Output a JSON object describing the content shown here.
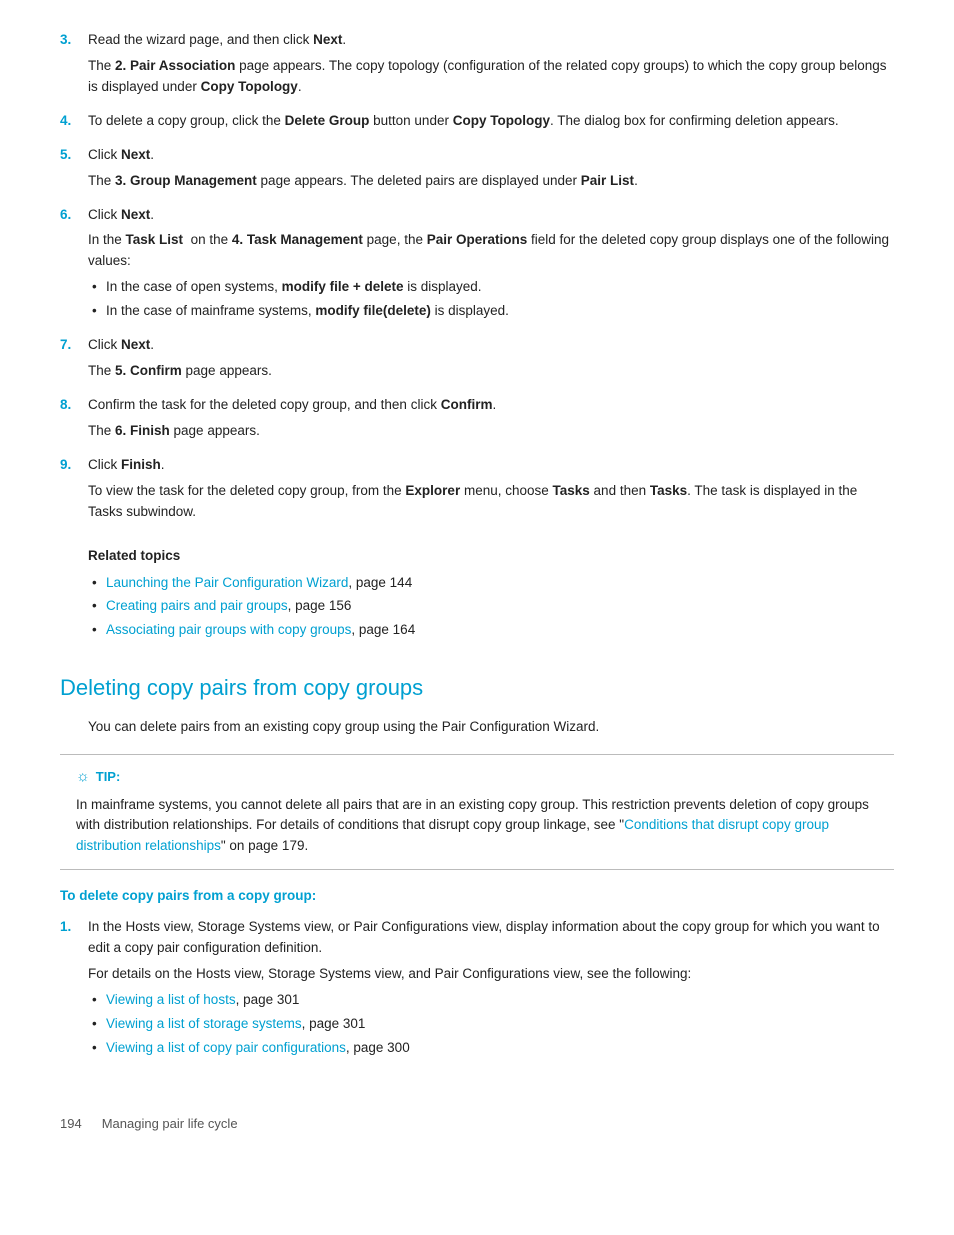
{
  "steps_top": [
    {
      "num": "3.",
      "main": "Read the wizard page, and then click <b>Next</b>.",
      "sub": "The <b>2. Pair Association</b> page appears. The copy topology (configuration of the related copy groups) to which the copy group belongs is displayed under <b>Copy Topology</b>."
    },
    {
      "num": "4.",
      "main": "To delete a copy group, click the <b>Delete Group</b> button under <b>Copy Topology</b>. The dialog box for confirming deletion appears.",
      "sub": ""
    },
    {
      "num": "5.",
      "main": "Click <b>Next</b>.",
      "sub": "The <b>3. Group Management</b> page appears. The deleted pairs are displayed under <b>Pair List</b>."
    },
    {
      "num": "6.",
      "main": "Click <b>Next</b>.",
      "sub": "In the <b>Task List</b>  on the <b>4. Task Management</b> page, the <b>Pair Operations</b> field for the deleted copy group displays one of the following values:"
    }
  ],
  "step6_bullets": [
    "In the case of open systems, <b>modify file + delete</b> is displayed.",
    "In the case of mainframe systems, <b>modify file(delete)</b> is displayed."
  ],
  "steps_bottom": [
    {
      "num": "7.",
      "main": "Click <b>Next</b>.",
      "sub": "The <b>5. Confirm</b> page appears."
    },
    {
      "num": "8.",
      "main": "Confirm the task for the deleted copy group, and then click <b>Confirm</b>.",
      "sub": "The <b>6. Finish</b> page appears."
    },
    {
      "num": "9.",
      "main": "Click <b>Finish</b>.",
      "sub": "To view the task for the deleted copy group, from the <b>Explorer</b> menu, choose <b>Tasks</b> and then <b>Tasks</b>. The task is displayed in the Tasks subwindow."
    }
  ],
  "related_topics": {
    "title": "Related topics",
    "items": [
      {
        "text": "Launching the Pair Configuration Wizard",
        "page": "page 144"
      },
      {
        "text": "Creating pairs and pair groups",
        "page": "page 156"
      },
      {
        "text": "Associating pair groups with copy groups",
        "page": "page 164"
      }
    ]
  },
  "section": {
    "heading": "Deleting copy pairs from copy groups",
    "intro": "You can delete pairs from an existing copy group using the Pair Configuration Wizard."
  },
  "tip": {
    "label": "TIP:",
    "text": "In mainframe systems, you cannot delete all pairs that are in an existing copy group. This restriction prevents deletion of copy groups with distribution relationships. For details of conditions that disrupt copy group linkage, see “Conditions that disrupt copy group distribution relationships” on page 179."
  },
  "sub_heading": "To delete copy pairs from a copy group:",
  "steps_section2": [
    {
      "num": "1.",
      "main": "In the Hosts view, Storage Systems view, or Pair Configurations view, display information about the copy group for which you want to edit a copy pair configuration definition.",
      "sub": "For details on the Hosts view, Storage Systems view, and Pair Configurations view, see the following:"
    }
  ],
  "section2_bullets": [
    {
      "text": "Viewing a list of hosts",
      "page": "page 301"
    },
    {
      "text": "Viewing a list of storage systems",
      "page": "page 301"
    },
    {
      "text": "Viewing a list of copy pair configurations",
      "page": "page 300"
    }
  ],
  "footer": {
    "page": "194",
    "text": "Managing pair life cycle"
  }
}
